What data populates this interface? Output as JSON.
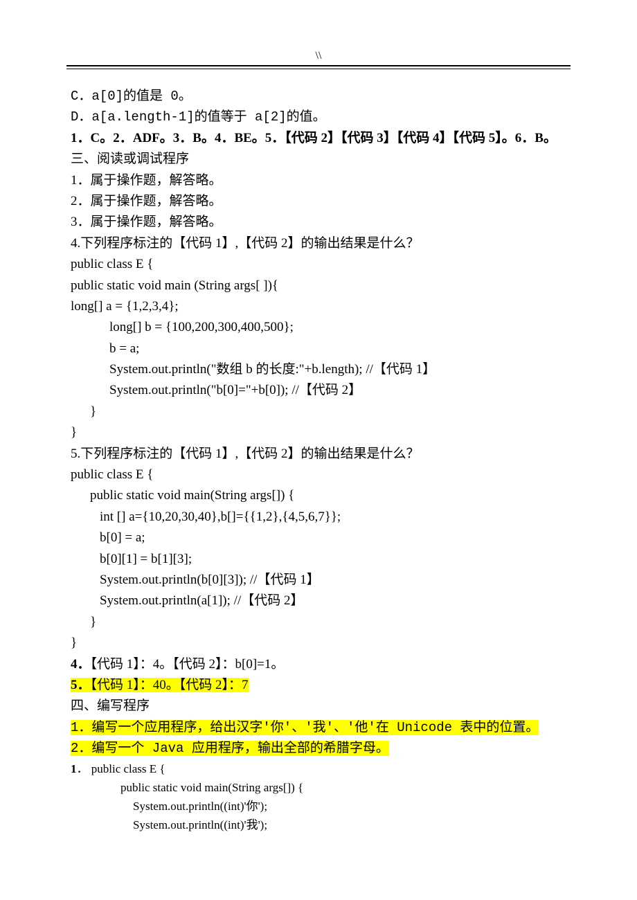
{
  "header": {
    "mark": "\\\\"
  },
  "opt": {
    "c": "C．a[0]的值是 0。",
    "d": "D．a[a.length-1]的值等于 a[2]的值。"
  },
  "ans1": "1．C。2．ADF。3．B。4．BE。5．【代码 2】【代码 3】【代码 4】【代码 5】。6．B。",
  "sec3": {
    "title": "三、阅读或调试程序",
    "i1": "1．属于操作题，解答略。",
    "i2": "2．属于操作题，解答略。",
    "i3": "3．属于操作题，解答略。",
    "q4": "4.下列程序标注的【代码 1】,【代码 2】的输出结果是什么？",
    "c4_1": "public class E {",
    "c4_2": "public static void main (String args[ ]){",
    "c4_3": "long[] a = {1,2,3,4};",
    "c4_4": "long[] b = {100,200,300,400,500};",
    "c4_5": "b = a;",
    "c4_6": "System.out.println(\"数组 b 的长度:\"+b.length); //【代码 1】",
    "c4_7": "System.out.println(\"b[0]=\"+b[0]); //【代码 2】",
    "c4_8": "}",
    "c4_9": "}",
    "q5": "5.下列程序标注的【代码 1】,【代码 2】的输出结果是什么？",
    "c5_1": "public class E {",
    "c5_2": "public static void main(String args[]) {",
    "c5_3": "int [] a={10,20,30,40},b[]={{1,2},{4,5,6,7}};",
    "c5_4": "b[0] = a;",
    "c5_5": "b[0][1] = b[1][3];",
    "c5_6": "System.out.println(b[0][3]); //【代码 1】",
    "c5_7": "System.out.println(a[1]);     //【代码 2】",
    "c5_8": "}",
    "c5_9": "}",
    "a4_pre": "4．",
    "a4_rest": "【代码 1】：4。【代码 2】：b[0]=1。",
    "a5_pre": "5．",
    "a5_rest": "【代码 1】：40。【代码 2】：7"
  },
  "sec4": {
    "title": "四、编写程序",
    "q1": "1．编写一个应用程序，给出汉字'你'、'我'、'他'在 Unicode 表中的位置。",
    "q2": "2．编写一个 Java 应用程序，输出全部的希腊字母。",
    "a1_pre": "1",
    "a1_rest": "．  public class E {",
    "a1_2": "public static void main(String args[]) {",
    "a1_3": "System.out.println((int)'你');",
    "a1_4": "System.out.println((int)'我');"
  }
}
